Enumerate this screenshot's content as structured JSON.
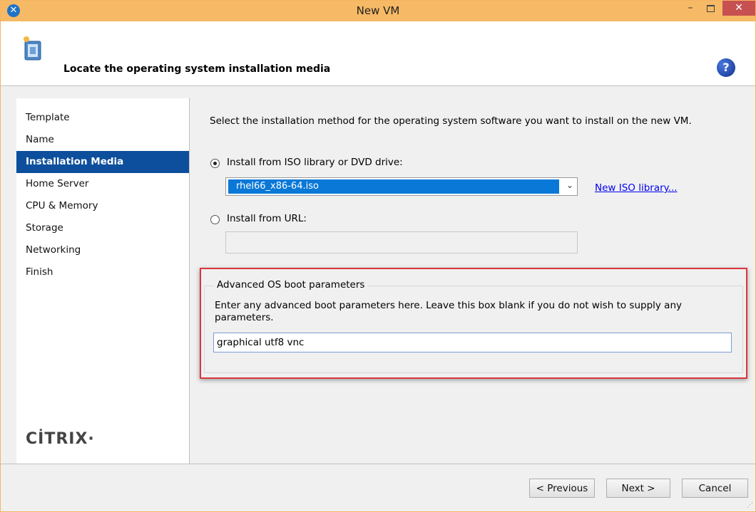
{
  "window": {
    "title": "New VM",
    "minimize": "–",
    "close": "✕"
  },
  "header": {
    "title": "Locate the operating system installation media",
    "help": "?"
  },
  "sidebar": {
    "items": [
      {
        "label": "Template"
      },
      {
        "label": "Name"
      },
      {
        "label": "Installation Media"
      },
      {
        "label": "Home Server"
      },
      {
        "label": "CPU & Memory"
      },
      {
        "label": "Storage"
      },
      {
        "label": "Networking"
      },
      {
        "label": "Finish"
      }
    ],
    "logo": "CİTRIX·"
  },
  "main": {
    "intro": "Select the installation method for the operating system software you want to install on the new VM.",
    "iso_option": {
      "label": "Install from ISO library or DVD drive:",
      "selected": true,
      "selected_value": "rhel66_x86-64.iso",
      "new_library_link": "New ISO library..."
    },
    "url_option": {
      "label": "Install from URL:",
      "selected": false,
      "value": ""
    },
    "advanced": {
      "group_title": "Advanced OS boot parameters",
      "description": "Enter any advanced boot parameters here. Leave this box blank if you do not wish to supply any parameters.",
      "value": "graphical utf8 vnc"
    }
  },
  "footer": {
    "previous": "< Previous",
    "next": "Next >",
    "cancel": "Cancel"
  },
  "colors": {
    "titlebar": "#f6b965",
    "active_nav": "#0d4f9c",
    "select_highlight": "#0a78d7",
    "annotation_border": "#d9363e",
    "link": "#0000ee"
  },
  "icons": [
    "app-icon",
    "wizard-icon",
    "help-icon",
    "chevron-down-icon",
    "resize-grip-icon"
  ]
}
